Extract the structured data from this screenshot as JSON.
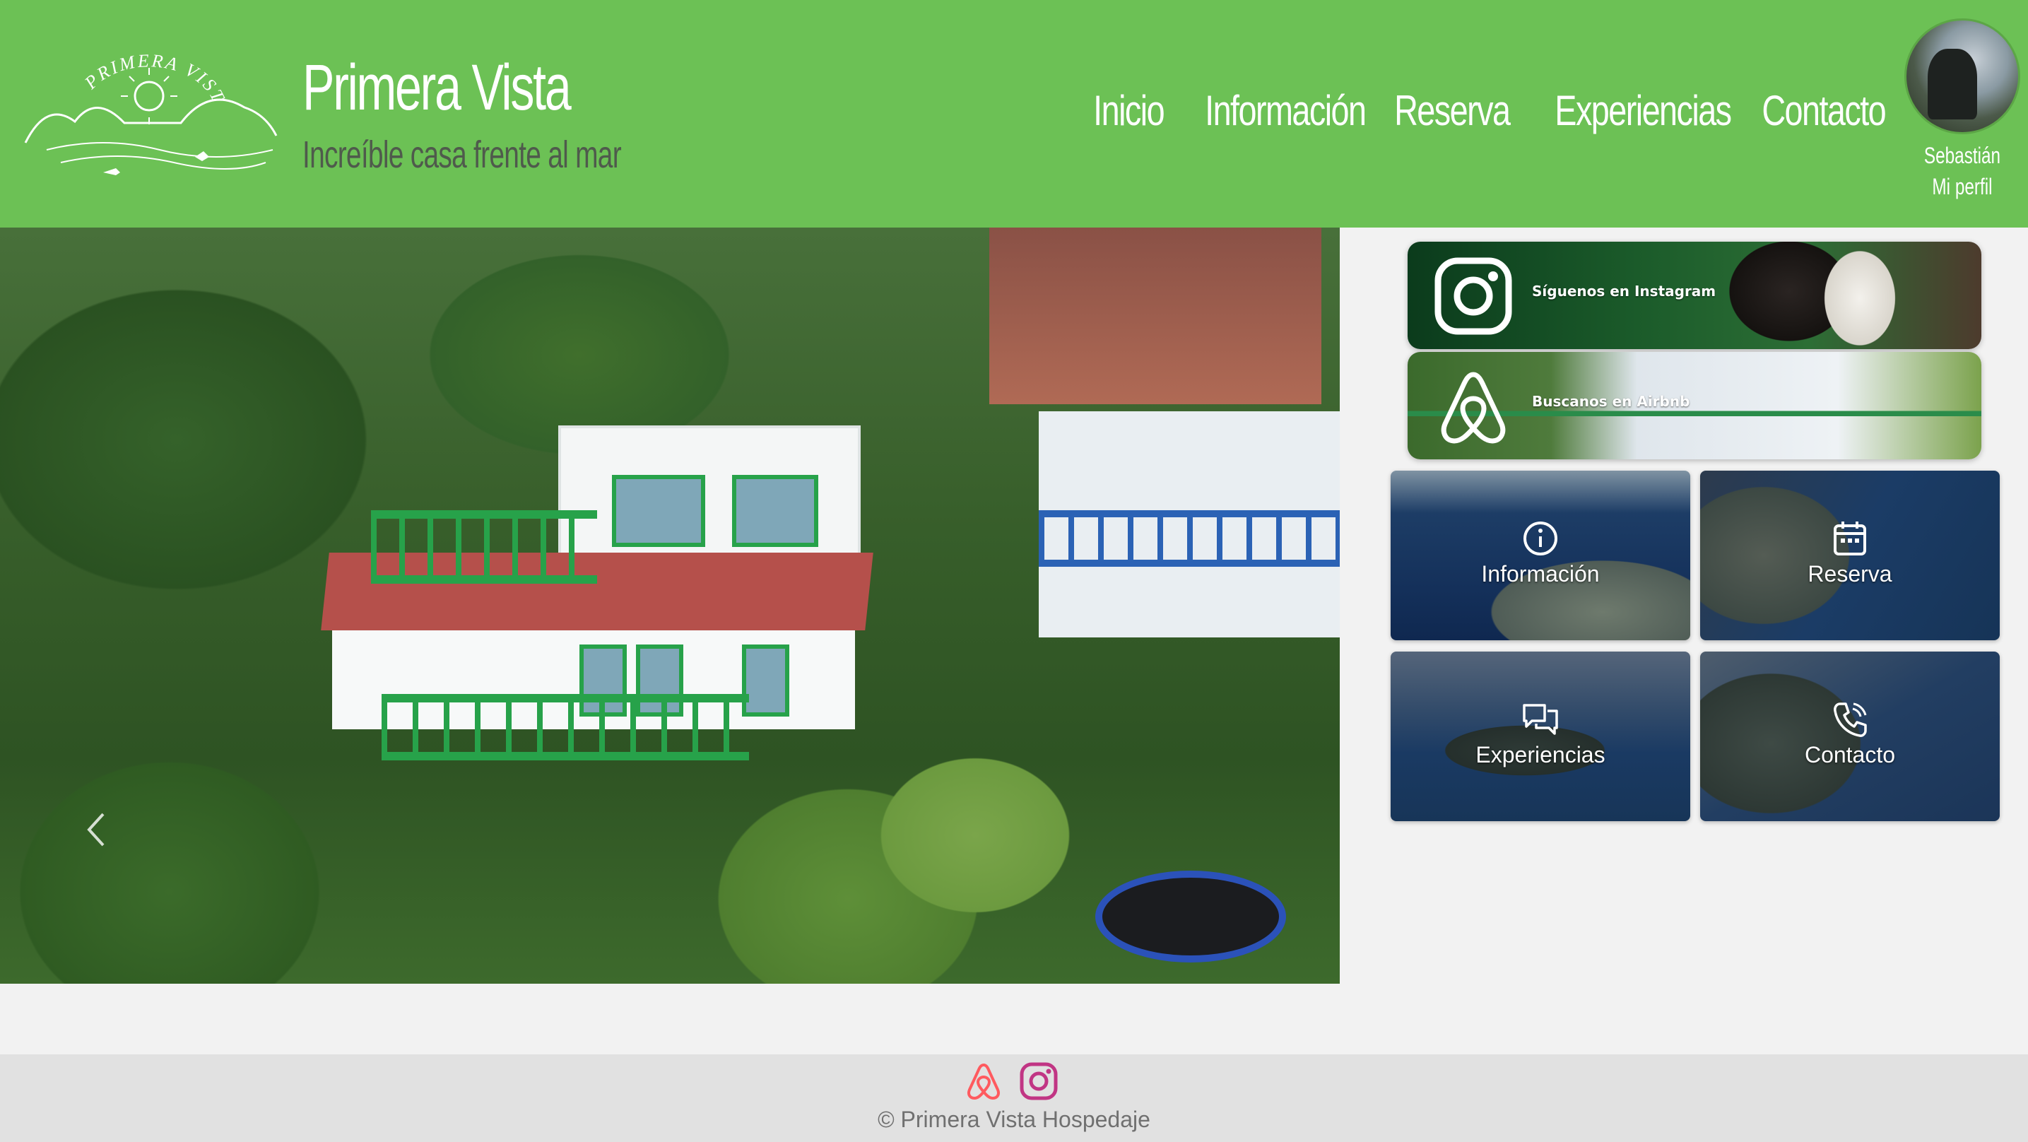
{
  "brand": {
    "logo_text": "PRIMERA VISTA",
    "title": "Primera Vista",
    "subtitle": "Increíble casa frente al mar"
  },
  "nav": {
    "items": [
      {
        "label": "Inicio"
      },
      {
        "label": "Información"
      },
      {
        "label": "Reserva"
      },
      {
        "label": "Experiencias"
      },
      {
        "label": "Contacto"
      }
    ]
  },
  "profile": {
    "name": "Sebastián",
    "link": "Mi perfil"
  },
  "carousel": {
    "slide_count": 6,
    "active_index": 0
  },
  "social": {
    "instagram_label": "Síguenos en Instagram",
    "airbnb_label": "Buscanos en Airbnb"
  },
  "tiles": [
    {
      "label": "Información",
      "icon": "info-icon"
    },
    {
      "label": "Reserva",
      "icon": "calendar-icon"
    },
    {
      "label": "Experiencias",
      "icon": "chat-icon"
    },
    {
      "label": "Contacto",
      "icon": "phone-icon"
    }
  ],
  "footer": {
    "copyright": "© Primera Vista Hospedaje",
    "airbnb_color": "#ff5a5f",
    "instagram_color": "#c13584"
  },
  "colors": {
    "header_bg": "#6cc155",
    "page_bg": "#f2f2f2",
    "footer_bg": "#e1e1e1"
  }
}
